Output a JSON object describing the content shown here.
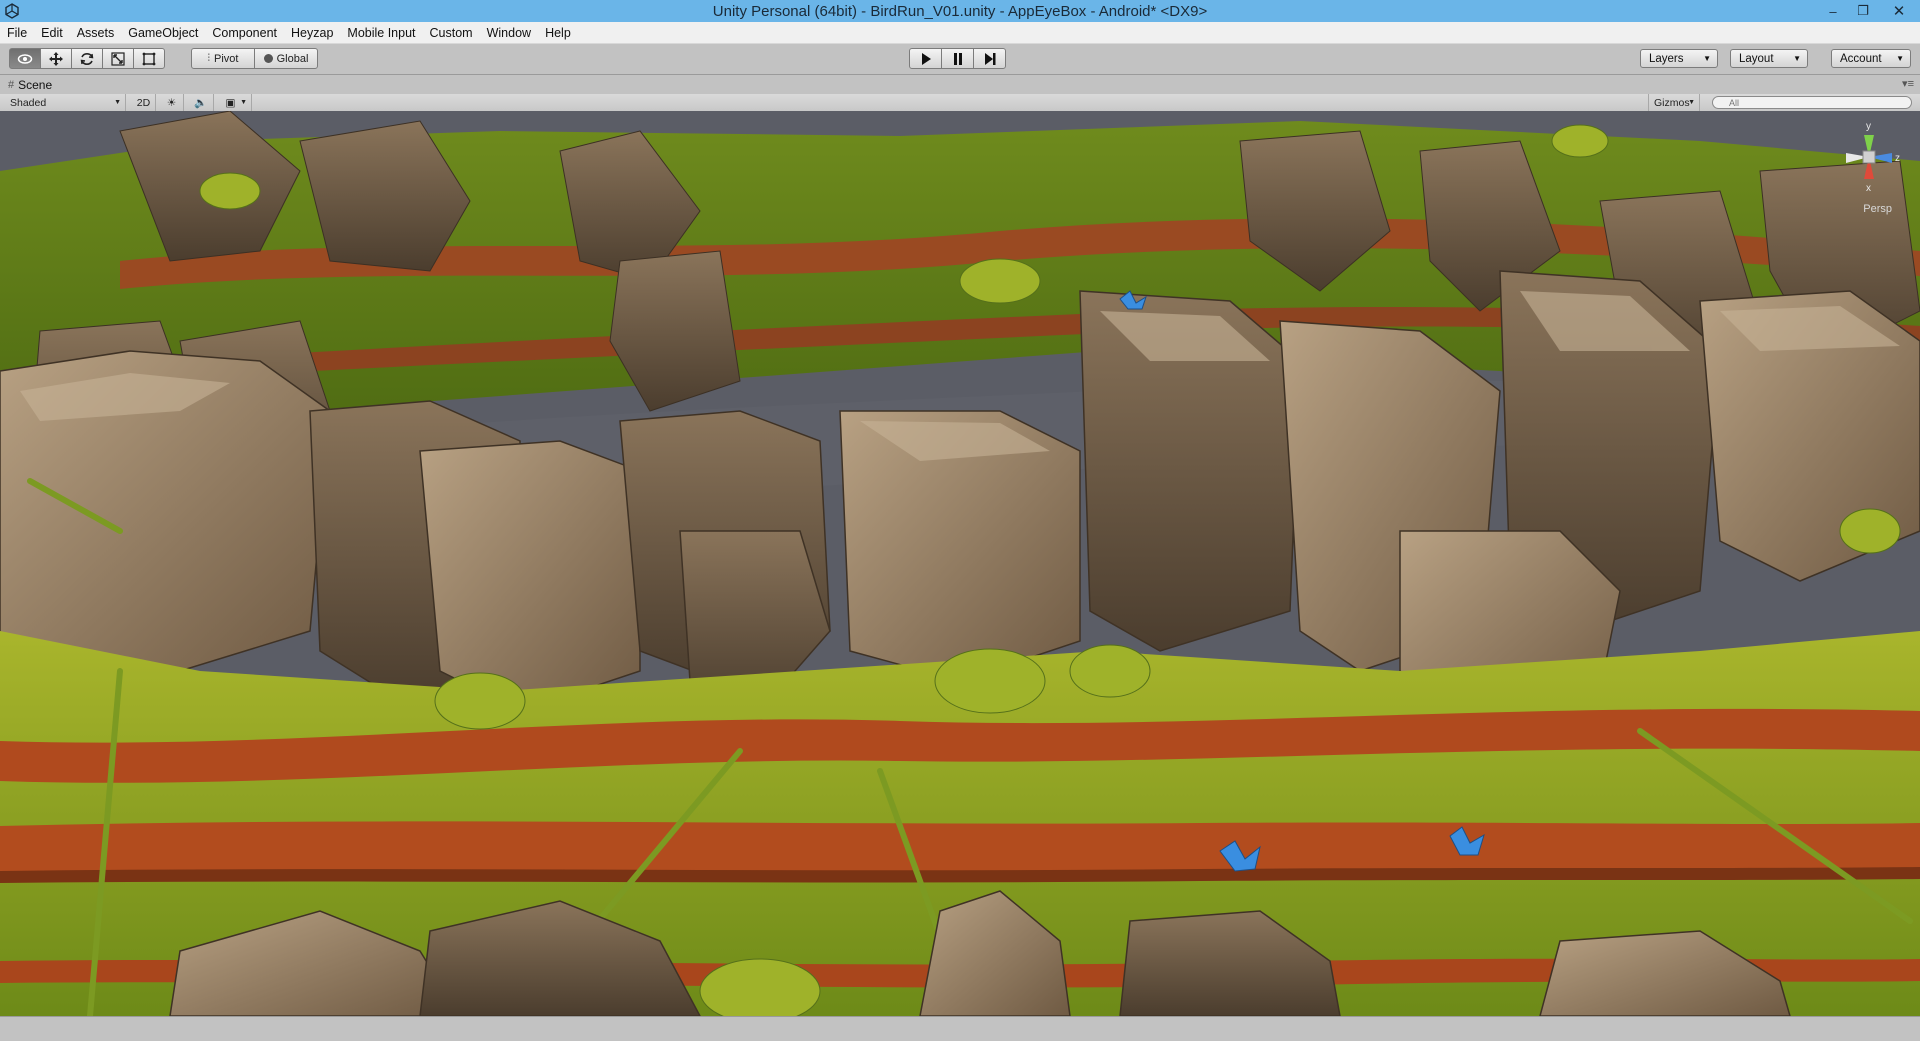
{
  "window": {
    "title": "Unity Personal (64bit) - BirdRun_V01.unity - AppEyeBox - Android* <DX9>",
    "controls": {
      "minimize": "–",
      "restore": "❐",
      "close": "✕"
    }
  },
  "menu": [
    "File",
    "Edit",
    "Assets",
    "GameObject",
    "Component",
    "Heyzap",
    "Mobile Input",
    "Custom",
    "Window",
    "Help"
  ],
  "toolbar": {
    "tools": [
      {
        "name": "hand-tool",
        "icon": "eye-icon",
        "active": true
      },
      {
        "name": "move-tool",
        "icon": "move-arrows-icon",
        "active": false
      },
      {
        "name": "rotate-tool",
        "icon": "rotate-icon",
        "active": false
      },
      {
        "name": "scale-tool",
        "icon": "scale-icon",
        "active": false
      },
      {
        "name": "rect-tool",
        "icon": "rect-icon",
        "active": false
      }
    ],
    "pivot_label": "Pivot",
    "global_label": "Global",
    "layers_label": "Layers",
    "layout_label": "Layout",
    "account_label": "Account"
  },
  "scene": {
    "tab_label": "Scene",
    "shading_mode": "Shaded",
    "mode_2d_label": "2D",
    "gizmos_label": "Gizmos",
    "search_placeholder": "All",
    "projection_label": "Persp",
    "gizmo_axes": {
      "y": "y",
      "z": "z",
      "x": "x"
    }
  },
  "colors": {
    "title_bar": "#6ab5e8",
    "editor_gray": "#c2c2c2",
    "sky": "#5b5d66",
    "grass": "#8fa421",
    "dirt_path": "#b04a1e",
    "rock": "#8c7356",
    "gizmo_y": "#7fd14a",
    "gizmo_z": "#4a8be0",
    "gizmo_x": "#e04a3a"
  }
}
